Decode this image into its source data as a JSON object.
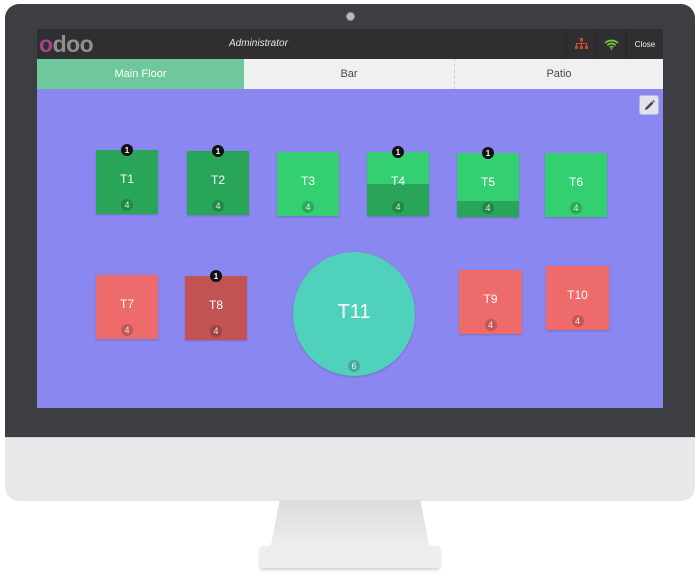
{
  "app": {
    "logo": {
      "first": "o",
      "rest": "doo"
    },
    "user": "Administrator",
    "close_label": "Close",
    "network_icon": "network-icon",
    "wifi_icon": "wifi-icon"
  },
  "floors": [
    {
      "label": "Main Floor",
      "active": true
    },
    {
      "label": "Bar",
      "active": false
    },
    {
      "label": "Patio",
      "active": false
    }
  ],
  "colors": {
    "floor_background": "#8a88f0",
    "active_tab": "#6ec89b",
    "table_green": "#34cf70",
    "table_green_dark": "#28a558",
    "table_red": "#ed6b6b",
    "table_red_dark": "#c25353",
    "table_teal": "#4fd1bb"
  },
  "tables": [
    {
      "name": "T1",
      "seats": "4",
      "orders": "1",
      "fill": 1.0
    },
    {
      "name": "T2",
      "seats": "4",
      "orders": "1",
      "fill": 1.0
    },
    {
      "name": "T3",
      "seats": "4",
      "orders": "",
      "fill": 0
    },
    {
      "name": "T4",
      "seats": "4",
      "orders": "1",
      "fill": 0.5
    },
    {
      "name": "T5",
      "seats": "4",
      "orders": "1",
      "fill": 0.25
    },
    {
      "name": "T6",
      "seats": "4",
      "orders": "",
      "fill": 0
    },
    {
      "name": "T7",
      "seats": "4",
      "orders": "",
      "fill": 0
    },
    {
      "name": "T8",
      "seats": "4",
      "orders": "1",
      "fill": 0
    },
    {
      "name": "T11",
      "seats": "6",
      "orders": "",
      "fill": 0
    },
    {
      "name": "T9",
      "seats": "4",
      "orders": "",
      "fill": 0
    },
    {
      "name": "T10",
      "seats": "4",
      "orders": "",
      "fill": 0
    }
  ]
}
